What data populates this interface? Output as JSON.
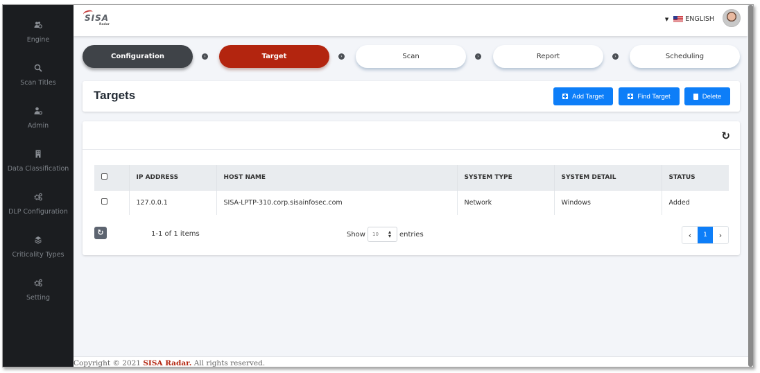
{
  "sidebar": {
    "items": [
      {
        "label": "Engine",
        "icon": "users-cog-icon"
      },
      {
        "label": "Scan Titles",
        "icon": "search-icon"
      },
      {
        "label": "Admin",
        "icon": "user-cog-icon"
      },
      {
        "label": "Data Classification",
        "icon": "building-icon"
      },
      {
        "label": "DLP Configuration",
        "icon": "cogs-icon"
      },
      {
        "label": "Criticality Types",
        "icon": "layers-icon"
      },
      {
        "label": "Setting",
        "icon": "cogs-icon"
      }
    ]
  },
  "topbar": {
    "logo_text": "SISA",
    "logo_sub": "Radar",
    "language": "ENGLISH"
  },
  "stepper": {
    "steps": [
      {
        "label": "Configuration",
        "state": "done"
      },
      {
        "label": "Target",
        "state": "active"
      },
      {
        "label": "Scan",
        "state": "pending"
      },
      {
        "label": "Report",
        "state": "pending"
      },
      {
        "label": "Scheduling",
        "state": "pending"
      }
    ]
  },
  "header": {
    "title": "Targets",
    "buttons": {
      "add": "Add Target",
      "find": "Find Target",
      "delete": "Delete"
    }
  },
  "table": {
    "columns": [
      "IP ADDRESS",
      "HOST NAME",
      "SYSTEM TYPE",
      "SYSTEM DETAIL",
      "STATUS"
    ],
    "rows": [
      {
        "ip": "127.0.0.1",
        "host": "SISA-LPTP-310.corp.sisainfosec.com",
        "type": "Network",
        "detail": "Windows",
        "status": "Added"
      }
    ],
    "items_count": "1-1 of 1 items",
    "show_label": "Show",
    "entries_label": "entries",
    "page_size": "10",
    "current_page": "1",
    "prev": "‹",
    "next": "›"
  },
  "footer": {
    "prefix": "Copyright © 2021 ",
    "brand": "SISA Radar.",
    "suffix": " All rights reserved."
  },
  "colors": {
    "active_step": "#b3250f",
    "done_step": "#3f4348",
    "primary_button": "#0d7ef8",
    "sidebar_bg": "#1b1d20"
  }
}
